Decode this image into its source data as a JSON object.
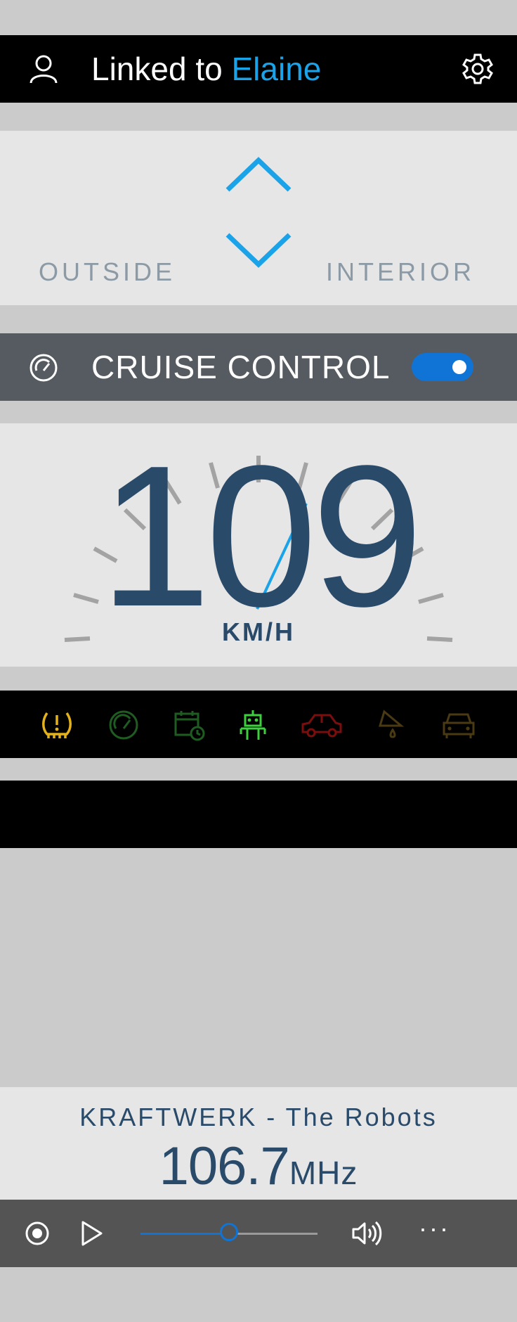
{
  "header": {
    "title_prefix": "Linked to ",
    "title_name": "Elaine",
    "user_icon": "user-icon",
    "settings_icon": "gear-icon"
  },
  "direction": {
    "left_label": "OUTSIDE",
    "right_label": "INTERIOR",
    "up_icon": "chevron-up-icon",
    "down_icon": "chevron-down-icon"
  },
  "cruise": {
    "label": "CRUISE CONTROL",
    "icon": "speedometer-icon",
    "enabled": true
  },
  "speed": {
    "value": "109",
    "unit": "KM/H"
  },
  "status_icons": [
    {
      "name": "tire-pressure-warning-icon",
      "color": "#e3b21a"
    },
    {
      "name": "speedometer-icon",
      "color": "#1f5c22"
    },
    {
      "name": "calendar-clock-icon",
      "color": "#1f5c22"
    },
    {
      "name": "robot-icon",
      "color": "#3ecf3e"
    },
    {
      "name": "car-side-icon",
      "color": "#7a0e0e"
    },
    {
      "name": "oil-can-icon",
      "color": "#4a3a14"
    },
    {
      "name": "car-front-icon",
      "color": "#4a3a14"
    }
  ],
  "radio": {
    "song": "KRAFTWERK - The Robots",
    "frequency": "106.7",
    "frequency_unit": "MHz"
  },
  "player": {
    "record_icon": "record-icon",
    "play_icon": "play-icon",
    "volume_icon": "volume-icon",
    "more_label": "···",
    "progress": 0.5
  },
  "colors": {
    "accent": "#1aa3e8",
    "toggle_on": "#0f74d6",
    "speed_text": "#2a4a6a"
  }
}
